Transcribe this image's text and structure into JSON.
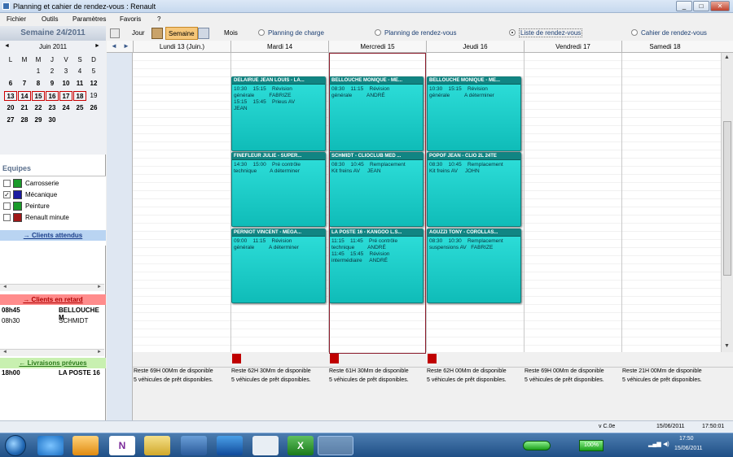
{
  "window": {
    "title": "Planning et cahier de rendez-vous : Renault",
    "btn_min": "_",
    "btn_max": "□",
    "btn_close": "✕"
  },
  "menu": [
    "Fichier",
    "Outils",
    "Paramètres",
    "Favoris",
    "?"
  ],
  "left": {
    "week_title": "Semaine 24/2011",
    "calendar": {
      "month": "Juin 2011",
      "prev": "◄",
      "next": "►",
      "dow": [
        "L",
        "M",
        "M",
        "J",
        "V",
        "S",
        "D"
      ],
      "weeks": [
        [
          "",
          "",
          "1",
          "2",
          "3",
          "4",
          "5"
        ],
        [
          "6",
          "7",
          "8",
          "9",
          "10",
          "11",
          "12"
        ],
        [
          "13",
          "14",
          "15",
          "16",
          "17",
          "18",
          "19"
        ],
        [
          "20",
          "21",
          "22",
          "23",
          "24",
          "25",
          "26"
        ],
        [
          "27",
          "28",
          "29",
          "30",
          "",
          "",
          ""
        ]
      ]
    },
    "equipes_title": "Equipes",
    "equipes": [
      {
        "label": "Carrosserie",
        "color": "#1a9a2a",
        "checked": ""
      },
      {
        "label": "Mécanique",
        "color": "#1a1aa0",
        "checked": "✓"
      },
      {
        "label": "Peinture",
        "color": "#1a9a2a",
        "checked": ""
      },
      {
        "label": "Renault minute",
        "color": "#a01818",
        "checked": ""
      }
    ],
    "clients_attendus": {
      "label": "→ Clients attendus",
      "color": "#b9d4f2"
    },
    "clients_retard": {
      "label": "→ Clients en retard",
      "color": "#ff8c8c",
      "rows": [
        {
          "time": "08h45",
          "name": "BELLOUCHE M"
        },
        {
          "time": "08h30",
          "name": "SCHMIDT"
        }
      ]
    },
    "livraisons": {
      "label": "← Livraisons prévues",
      "color": "#c8f0b0",
      "rows": [
        {
          "time": "18h00",
          "name": "LA POSTE 16"
        }
      ]
    },
    "scroll_left": "◄",
    "scroll_right": "►"
  },
  "toolbar": {
    "jour": "Jour",
    "semaine": "Semaine",
    "mois": "Mois",
    "views": [
      "Planning de charge",
      "Planning de rendez-vous",
      "Liste de rendez-vous",
      "Cahier de rendez-vous"
    ],
    "selected_view": "Liste de rendez-vous"
  },
  "nav": {
    "prev": "◄",
    "next": "►"
  },
  "days": [
    "Lundi 13 (Juin.)",
    "Mardi 14",
    "Mercredi 15",
    "Jeudi 16",
    "Vendredi 17",
    "Samedi 18"
  ],
  "appointments": [
    {
      "day": 1,
      "slot": 0,
      "title": "DELAIRUE JEAN LOUIS - LA...",
      "lines": [
        "10:30    15:15    Révision",
        "générale          FABRIZE",
        "15:15    15:45    Prieus AV",
        "JEAN"
      ]
    },
    {
      "day": 1,
      "slot": 1,
      "title": "FINEFLEUR JULIE - SUPER...",
      "lines": [
        "14:30    15:00    Pré contrôle",
        "technique         A déterminer"
      ]
    },
    {
      "day": 1,
      "slot": 2,
      "title": "PERNIOT VINCENT - MÉGA...",
      "lines": [
        "09:00    11:15    Révision",
        "générale          A déterminer"
      ]
    },
    {
      "day": 2,
      "slot": 0,
      "title": "BELLOUCHE MONIQUE - ME...",
      "lines": [
        "08:30    11:15    Révision",
        "générale          ANDRÉ"
      ]
    },
    {
      "day": 2,
      "slot": 1,
      "title": "SCHMIDT - CLIOCLUB MED ...",
      "lines": [
        "08:30    10:45    Remplacement",
        "Kit freins AV     JEAN"
      ]
    },
    {
      "day": 2,
      "slot": 2,
      "title": "LA POSTE 16 - KANGOO L.S...",
      "lines": [
        "11:15    11:45    Pré contrôle",
        "technique         ANDRÉ",
        "11:45    15:45    Révision",
        "intermédiaire     ANDRÉ"
      ]
    },
    {
      "day": 3,
      "slot": 0,
      "title": "BELLOUCHE MONIQUE - ME...",
      "lines": [
        "10:30    15:15    Révision",
        "générale          A déterminer"
      ]
    },
    {
      "day": 3,
      "slot": 1,
      "title": "POPOF JEAN - CLIO 2L 24TE",
      "lines": [
        "08:30    10:45    Remplacement",
        "Kit freins AV     JOHN"
      ]
    },
    {
      "day": 3,
      "slot": 2,
      "title": "AGUZZI TONY - COROLLAS...",
      "lines": [
        "08:30    10:30    Remplacement",
        "suspensions AV   FABRIZE"
      ]
    }
  ],
  "red_markers": [
    1,
    2,
    3
  ],
  "availability": [
    "Reste 69H 00Mm de disponible",
    "Reste 62H 30Mm de disponible",
    "Reste 61H 30Mm de disponible",
    "Reste 62H 00Mm de disponible",
    "Reste 69H 00Mm de disponible",
    "Reste 21H 00Mm de disponible"
  ],
  "vehicles": "5 véhicules de prêt disponibles.",
  "status": {
    "version": "v C.0e",
    "date": "15/06/2011",
    "time": "17:50:01"
  },
  "taskbar": {
    "battery": "100%",
    "clock_time": "17:50",
    "clock_date": "15/06/2011",
    "onenote": "N",
    "excel": "X"
  }
}
